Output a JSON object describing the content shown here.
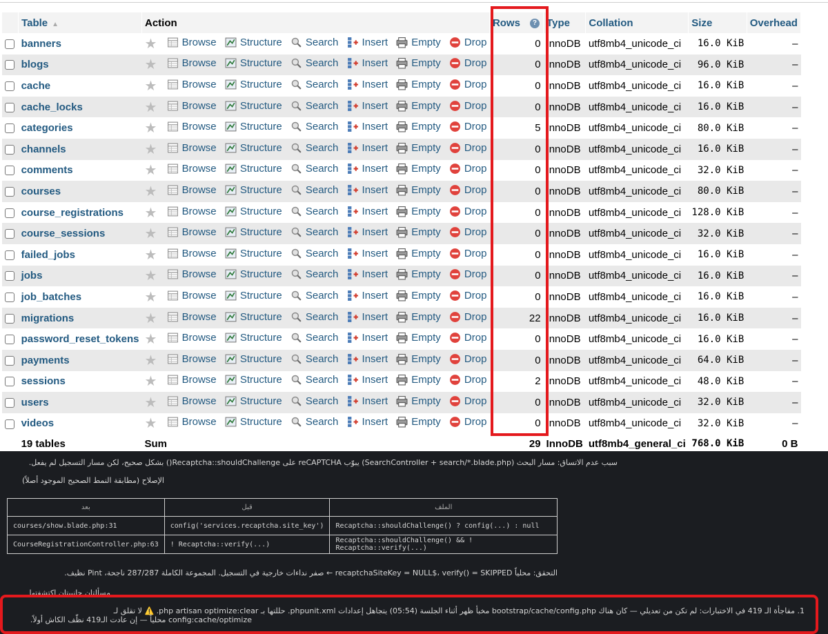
{
  "headers": {
    "table": "Table",
    "action": "Action",
    "rows": "Rows",
    "type": "Type",
    "collation": "Collation",
    "size": "Size",
    "overhead": "Overhead"
  },
  "actions": {
    "browse": "Browse",
    "structure": "Structure",
    "search": "Search",
    "insert": "Insert",
    "empty": "Empty",
    "drop": "Drop"
  },
  "tables": [
    {
      "name": "banners",
      "rows": "0",
      "type": "InnoDB",
      "collation": "utf8mb4_unicode_ci",
      "size": "16.0 KiB",
      "overhead": "–"
    },
    {
      "name": "blogs",
      "rows": "0",
      "type": "InnoDB",
      "collation": "utf8mb4_unicode_ci",
      "size": "96.0 KiB",
      "overhead": "–"
    },
    {
      "name": "cache",
      "rows": "0",
      "type": "InnoDB",
      "collation": "utf8mb4_unicode_ci",
      "size": "16.0 KiB",
      "overhead": "–"
    },
    {
      "name": "cache_locks",
      "rows": "0",
      "type": "InnoDB",
      "collation": "utf8mb4_unicode_ci",
      "size": "16.0 KiB",
      "overhead": "–"
    },
    {
      "name": "categories",
      "rows": "5",
      "type": "InnoDB",
      "collation": "utf8mb4_unicode_ci",
      "size": "80.0 KiB",
      "overhead": "–"
    },
    {
      "name": "channels",
      "rows": "0",
      "type": "InnoDB",
      "collation": "utf8mb4_unicode_ci",
      "size": "16.0 KiB",
      "overhead": "–"
    },
    {
      "name": "comments",
      "rows": "0",
      "type": "InnoDB",
      "collation": "utf8mb4_unicode_ci",
      "size": "32.0 KiB",
      "overhead": "–"
    },
    {
      "name": "courses",
      "rows": "0",
      "type": "InnoDB",
      "collation": "utf8mb4_unicode_ci",
      "size": "80.0 KiB",
      "overhead": "–"
    },
    {
      "name": "course_registrations",
      "rows": "0",
      "type": "InnoDB",
      "collation": "utf8mb4_unicode_ci",
      "size": "128.0 KiB",
      "overhead": "–"
    },
    {
      "name": "course_sessions",
      "rows": "0",
      "type": "InnoDB",
      "collation": "utf8mb4_unicode_ci",
      "size": "32.0 KiB",
      "overhead": "–"
    },
    {
      "name": "failed_jobs",
      "rows": "0",
      "type": "InnoDB",
      "collation": "utf8mb4_unicode_ci",
      "size": "16.0 KiB",
      "overhead": "–"
    },
    {
      "name": "jobs",
      "rows": "0",
      "type": "InnoDB",
      "collation": "utf8mb4_unicode_ci",
      "size": "16.0 KiB",
      "overhead": "–"
    },
    {
      "name": "job_batches",
      "rows": "0",
      "type": "InnoDB",
      "collation": "utf8mb4_unicode_ci",
      "size": "16.0 KiB",
      "overhead": "–"
    },
    {
      "name": "migrations",
      "rows": "22",
      "type": "InnoDB",
      "collation": "utf8mb4_unicode_ci",
      "size": "16.0 KiB",
      "overhead": "–"
    },
    {
      "name": "password_reset_tokens",
      "rows": "0",
      "type": "InnoDB",
      "collation": "utf8mb4_unicode_ci",
      "size": "16.0 KiB",
      "overhead": "–"
    },
    {
      "name": "payments",
      "rows": "0",
      "type": "InnoDB",
      "collation": "utf8mb4_unicode_ci",
      "size": "64.0 KiB",
      "overhead": "–"
    },
    {
      "name": "sessions",
      "rows": "2",
      "type": "InnoDB",
      "collation": "utf8mb4_unicode_ci",
      "size": "48.0 KiB",
      "overhead": "–"
    },
    {
      "name": "users",
      "rows": "0",
      "type": "InnoDB",
      "collation": "utf8mb4_unicode_ci",
      "size": "32.0 KiB",
      "overhead": "–"
    },
    {
      "name": "videos",
      "rows": "0",
      "type": "InnoDB",
      "collation": "utf8mb4_unicode_ci",
      "size": "32.0 KiB",
      "overhead": "–"
    }
  ],
  "summary": {
    "count": "19 tables",
    "label": "Sum",
    "rows": "29",
    "type": "InnoDB",
    "collation": "utf8mb4_general_ci",
    "size": "768.0 KiB",
    "overhead": "0 B"
  },
  "notes": {
    "line1": "سبب عدم الاتساق: مسار البحث (SearchController + search/*.blade.php) يبوّب reCAPTCHA على Recaptcha::shouldChallenge() بشكل صحيح، لكن مسار التسجيل لم يفعل.",
    "line2": "الإصلاح (مطابقة النمط الصحيح الموجود أصلاً)",
    "table_headers": [
      "بعد",
      "قبل",
      "الملف"
    ],
    "table_rows": [
      [
        "courses/show.blade.php:31",
        "config('services.recaptcha.site_key')",
        "Recaptcha::shouldChallenge() ? config(...) : null"
      ],
      [
        "CourseRegistrationController.php:63",
        "! Recaptcha::verify(...)",
        "Recaptcha::shouldChallenge() && ! Recaptcha::verify(...)"
      ]
    ],
    "line3": "التحقق: محلياً recaptchaSiteKey = NULL$، verify() = SKIPPED ← صفر نداءات خارجية في التسجيل. المجموعة الكاملة 287/287 ناجحة، Pint نظيف.",
    "line4": "مسألتان جانبيتان اكتشفتها",
    "line5": "1. مفاجأة الـ 419 في الاختبارات: لم تكن من تعديلي — كان هناك bootstrap/cache/config.php مخبأ ظهر أثناء الجلسة (05:54) يتجاهل إعدادات phpunit.xml. حللتها بـ php artisan optimize:clear. ⚠️ لا تقلق لـ",
    "line6": "config:cache/optimize محلياً — إن عادت الـ419 نظّف الكاش أولاً."
  }
}
